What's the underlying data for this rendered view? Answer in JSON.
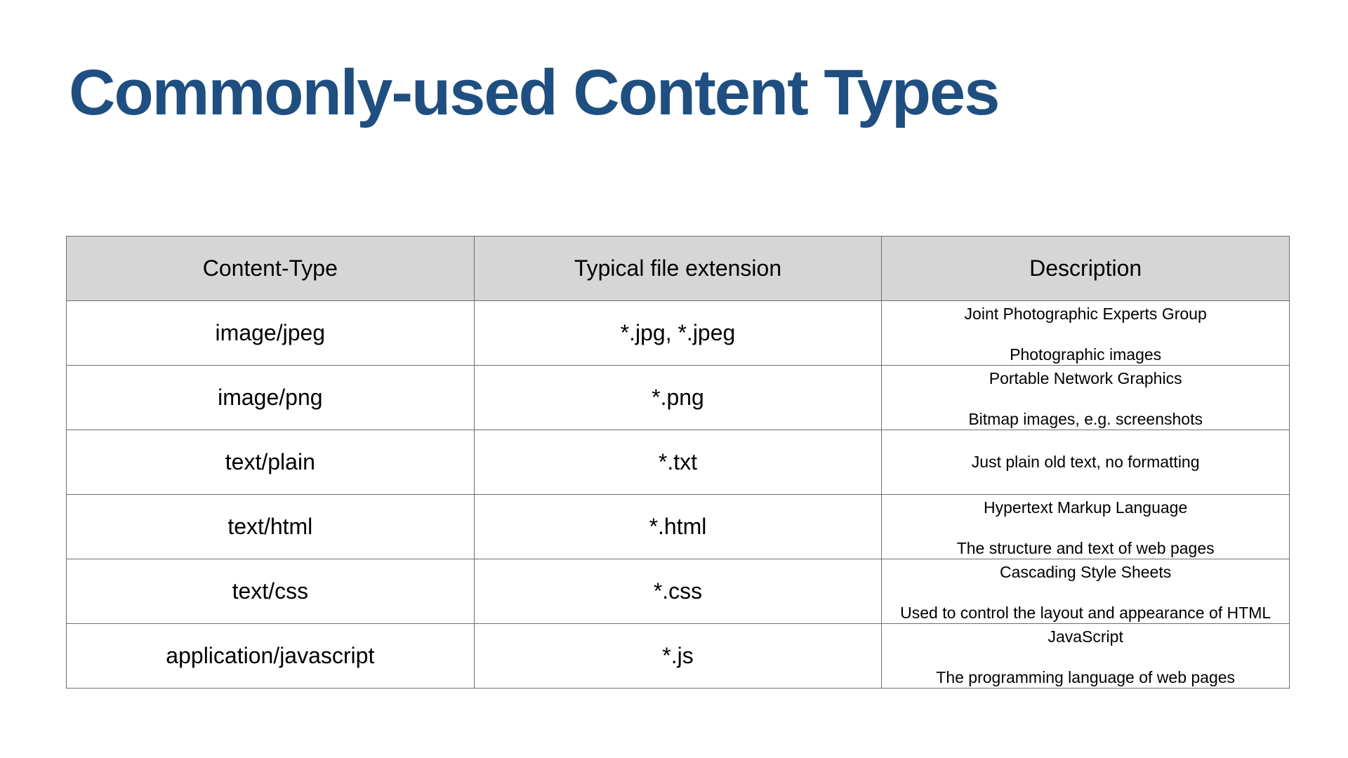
{
  "slide": {
    "title": "Commonly-used Content Types"
  },
  "table": {
    "headers": [
      "Content-Type",
      "Typical file extension",
      "Description"
    ],
    "rows": [
      {
        "content_type": "image/jpeg",
        "extension": "*.jpg, *.jpeg",
        "desc_title": "Joint Photographic Experts Group",
        "desc_detail": "Photographic images"
      },
      {
        "content_type": "image/png",
        "extension": "*.png",
        "desc_title": "Portable Network Graphics",
        "desc_detail": "Bitmap images, e.g. screenshots"
      },
      {
        "content_type": "text/plain",
        "extension": "*.txt",
        "desc_title": "Just plain old text, no formatting",
        "desc_detail": ""
      },
      {
        "content_type": "text/html",
        "extension": "*.html",
        "desc_title": "Hypertext Markup Language",
        "desc_detail": "The structure and text of web pages"
      },
      {
        "content_type": "text/css",
        "extension": "*.css",
        "desc_title": "Cascading Style Sheets",
        "desc_detail": "Used to control the layout and appearance of HTML"
      },
      {
        "content_type": "application/javascript",
        "extension": "*.js",
        "desc_title": "JavaScript",
        "desc_detail": "The programming language of web pages"
      }
    ]
  },
  "colors": {
    "title": "#1f4e80",
    "header_background": "#d6d6d6",
    "border": "#6e6e6e"
  }
}
